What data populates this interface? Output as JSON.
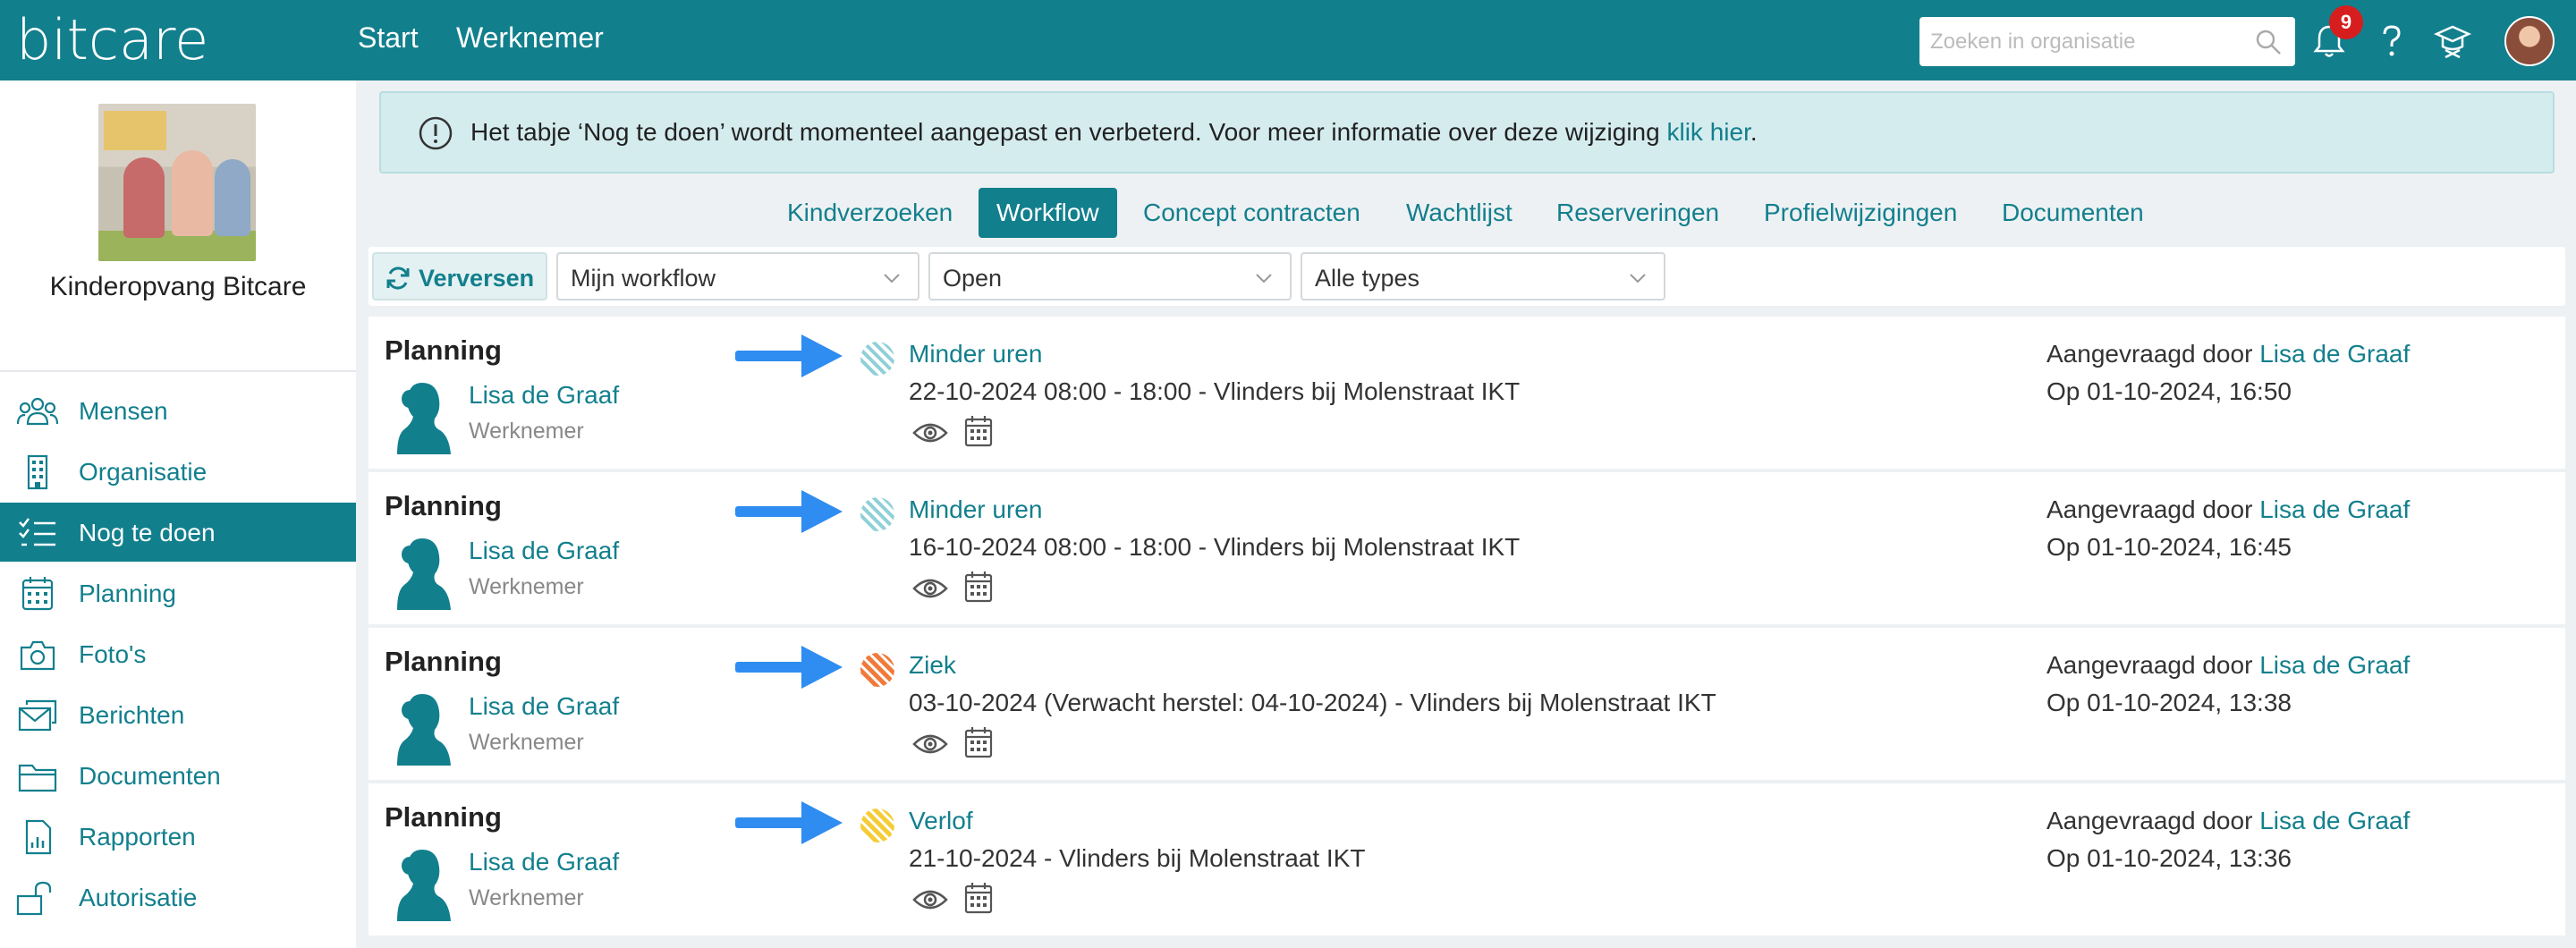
{
  "header": {
    "logo": "bitcare",
    "nav": [
      "Start",
      "Werknemer"
    ],
    "search_placeholder": "Zoeken in organisatie",
    "notification_count": "9",
    "icons": [
      "search-icon",
      "bell-icon",
      "help-icon",
      "graduation-icon",
      "user-avatar"
    ]
  },
  "sidebar": {
    "org_name": "Kinderopvang Bitcare",
    "items": [
      {
        "label": "Mensen",
        "icon": "people-icon"
      },
      {
        "label": "Organisatie",
        "icon": "building-icon"
      },
      {
        "label": "Nog te doen",
        "icon": "checklist-icon",
        "active": true
      },
      {
        "label": "Planning",
        "icon": "calendar-icon"
      },
      {
        "label": "Foto's",
        "icon": "camera-icon"
      },
      {
        "label": "Berichten",
        "icon": "mail-icon"
      },
      {
        "label": "Documenten",
        "icon": "folder-icon"
      },
      {
        "label": "Rapporten",
        "icon": "report-icon"
      },
      {
        "label": "Autorisatie",
        "icon": "lock-icon"
      }
    ]
  },
  "notice": {
    "text": "Het tabje ‘Nog te doen’ wordt momenteel aangepast en verbeterd. Voor meer informatie over deze wijziging ",
    "link": "klik hier",
    "end": "."
  },
  "tabs": [
    {
      "label": "Kindverzoeken"
    },
    {
      "label": "Workflow",
      "active": true
    },
    {
      "label": "Concept contracten"
    },
    {
      "label": "Wachtlijst"
    },
    {
      "label": "Reserveringen"
    },
    {
      "label": "Profielwijzigingen"
    },
    {
      "label": "Documenten"
    }
  ],
  "filters": {
    "refresh_label": "Verversen",
    "workflow_select": "Mijn workflow",
    "status_select": "Open",
    "type_select": "Alle types"
  },
  "rows": [
    {
      "type": "Planning",
      "person": "Lisa de Graaf",
      "role": "Werknemer",
      "title": "Minder uren",
      "detail": "22-10-2024 08:00 - 18:00 - Vlinders bij Molenstraat IKT",
      "requested_label": "Aangevraagd door ",
      "requested_by": "Lisa de Graaf",
      "when": "Op 01-10-2024, 16:50",
      "status_color": "#8fd0d8"
    },
    {
      "type": "Planning",
      "person": "Lisa de Graaf",
      "role": "Werknemer",
      "title": "Minder uren",
      "detail": "16-10-2024 08:00 - 18:00 - Vlinders bij Molenstraat IKT",
      "requested_label": "Aangevraagd door ",
      "requested_by": "Lisa de Graaf",
      "when": "Op 01-10-2024, 16:45",
      "status_color": "#8fd0d8"
    },
    {
      "type": "Planning",
      "person": "Lisa de Graaf",
      "role": "Werknemer",
      "title": "Ziek",
      "detail": "03-10-2024 (Verwacht herstel: 04-10-2024) - Vlinders bij Molenstraat IKT",
      "requested_label": "Aangevraagd door ",
      "requested_by": "Lisa de Graaf",
      "when": "Op 01-10-2024, 13:38",
      "status_color": "#f07a3a"
    },
    {
      "type": "Planning",
      "person": "Lisa de Graaf",
      "role": "Werknemer",
      "title": "Verlof",
      "detail": "21-10-2024 - Vlinders bij Molenstraat IKT",
      "requested_label": "Aangevraagd door ",
      "requested_by": "Lisa de Graaf",
      "when": "Op 01-10-2024, 13:36",
      "status_color": "#f5cc35"
    }
  ],
  "colors": {
    "brand": "#127f8d",
    "arrow": "#2f8cf0",
    "badge": "#d61e1e"
  }
}
